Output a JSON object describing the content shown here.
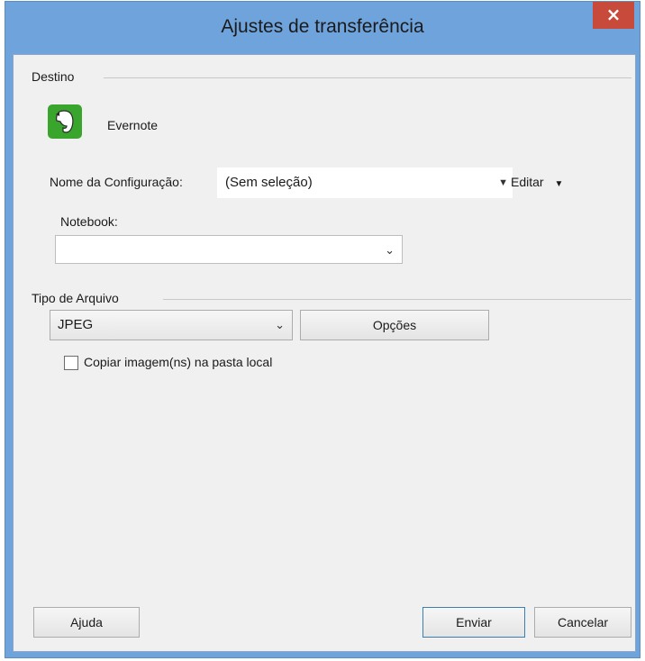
{
  "window": {
    "title": "Ajustes de transferência",
    "close_symbol": "×"
  },
  "destino": {
    "group_label": "Destino",
    "service_name": "Evernote",
    "service_icon": "evernote-elephant-icon",
    "config_label": "Nome da Configuração:",
    "config_value": "(Sem seleção)",
    "edit_label": "Editar",
    "notebook_label": "Notebook:",
    "notebook_value": ""
  },
  "tipo_arquivo": {
    "group_label": "Tipo de Arquivo",
    "format_value": "JPEG",
    "options_label": "Opções",
    "copy_checkbox_label": "Copiar imagem(ns) na pasta local",
    "copy_checked": false
  },
  "footer": {
    "help_label": "Ajuda",
    "send_label": "Enviar",
    "cancel_label": "Cancelar"
  },
  "colors": {
    "title_bar": "#6fa3dc",
    "close_button": "#c74a3a",
    "client_bg": "#f0f0f0",
    "evernote_green": "#3aa52c",
    "focus_border": "#3c7fb1"
  }
}
